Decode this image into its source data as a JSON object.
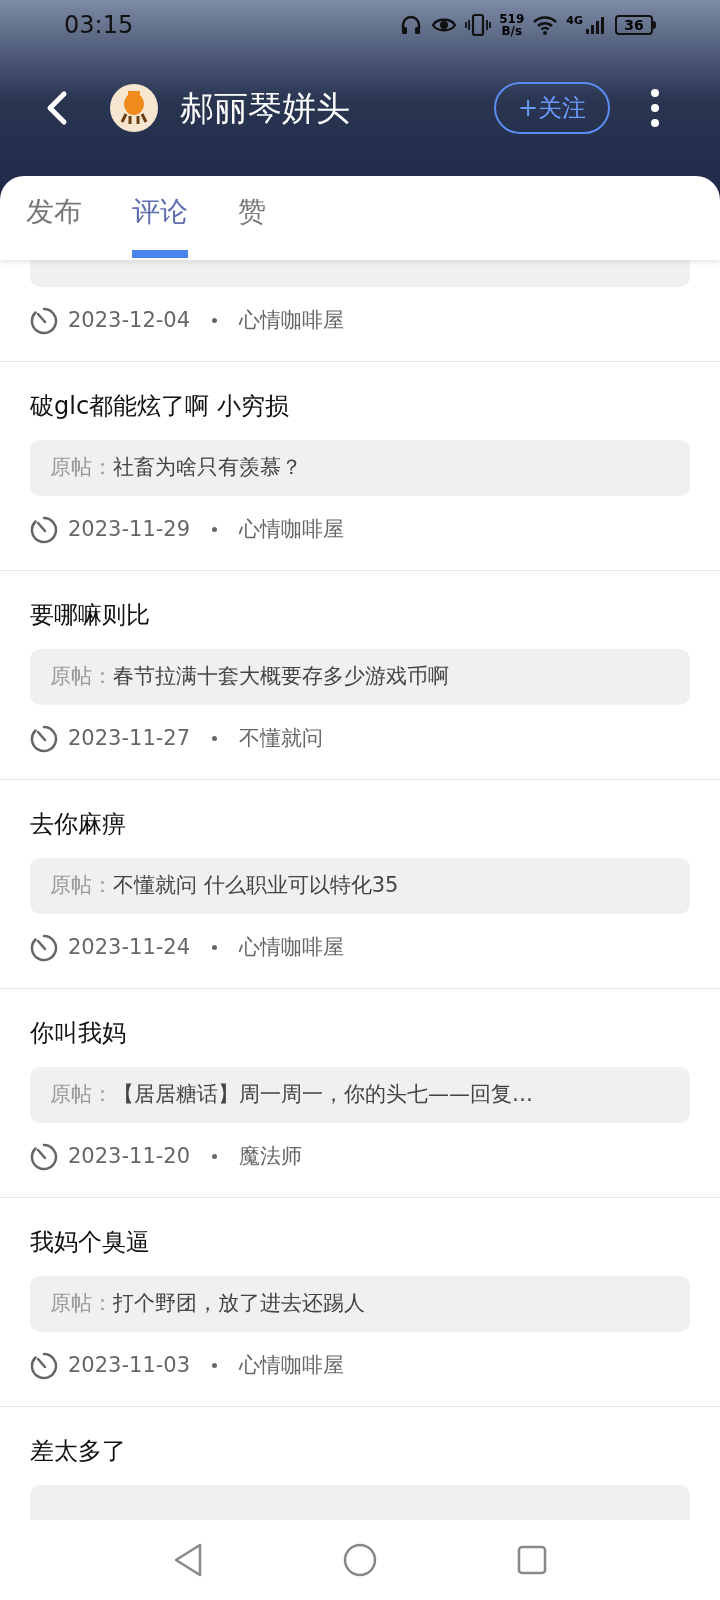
{
  "status_bar": {
    "time": "03:15",
    "speed_value": "519",
    "speed_unit": "B/s",
    "network": "4G",
    "battery": "36"
  },
  "header": {
    "title": "郝丽琴姘头",
    "follow_button": "+关注"
  },
  "tabs": [
    {
      "label": "发布",
      "selected": false
    },
    {
      "label": "评论",
      "selected": true
    },
    {
      "label": "赞",
      "selected": false
    }
  ],
  "comments": [
    {
      "date": "2023-12-04",
      "forum": "心情咖啡屋"
    },
    {
      "text": "破glc都能炫了啊 小穷损",
      "quote_label": "原帖：",
      "quote": "社畜为啥只有羡慕？",
      "date": "2023-11-29",
      "forum": "心情咖啡屋"
    },
    {
      "text": "要哪嘛则比",
      "quote_label": "原帖：",
      "quote": "春节拉满十套大概要存多少游戏币啊",
      "date": "2023-11-27",
      "forum": "不懂就问"
    },
    {
      "text": "去你麻痹",
      "quote_label": "原帖：",
      "quote": "不懂就问 什么职业可以特化35",
      "date": "2023-11-24",
      "forum": "心情咖啡屋"
    },
    {
      "text": "你叫我妈",
      "quote_label": "原帖：",
      "quote": "【居居糖话】周一周一，你的头七——回复…",
      "date": "2023-11-20",
      "forum": "魔法师"
    },
    {
      "text": "我妈个臭逼",
      "quote_label": "原帖：",
      "quote": "打个野团，放了进去还踢人",
      "date": "2023-11-03",
      "forum": "心情咖啡屋"
    },
    {
      "text": "差太多了"
    }
  ]
}
